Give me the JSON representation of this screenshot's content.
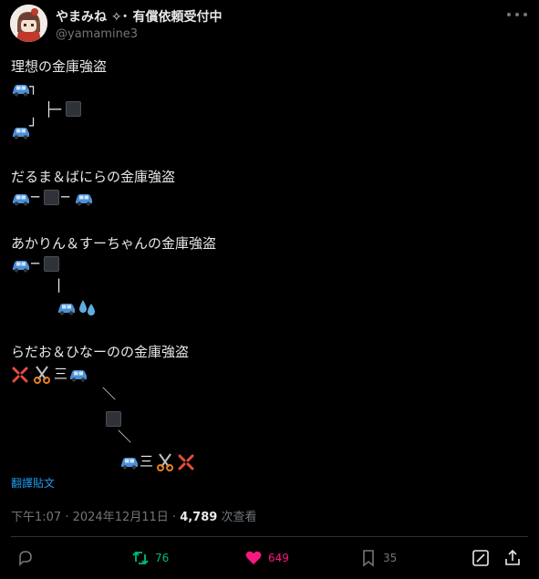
{
  "header": {
    "display_name": "やまみね ✧･ 有償依頼受付中",
    "handle": "@yamamine3"
  },
  "post": {
    "lines": [
      "理想の金庫強盗",
      "だるま＆ばにらの金庫強盗",
      "あかりん＆すーちゃんの金庫強盗",
      "らだお＆ひなーのの金庫強盗"
    ],
    "glyphs": {
      "corner_top": "┐",
      "tee": "├─",
      "corner_bottom": "┘",
      "dash": "─",
      "pipe": "|",
      "backslash": "＼",
      "speed": "三"
    }
  },
  "translate_label": "翻譯貼文",
  "meta": {
    "time": "下午1:07",
    "date": "2024年12月11日",
    "views": "4,789",
    "views_label": "次查看"
  },
  "actions": {
    "retweets": "76",
    "likes": "649",
    "bookmarks": "35"
  },
  "colors": {
    "background": "#000000",
    "text": "#e7e9ea",
    "muted": "#71767b",
    "link": "#1d9bf0",
    "retweet": "#00ba7c",
    "like": "#f91880"
  },
  "icons": [
    "car-icon",
    "vault-box-icon",
    "sweat-icon",
    "anger-icon",
    "scissors-icon",
    "reply-icon",
    "retweet-icon",
    "heart-icon",
    "bookmark-icon",
    "edit-icon",
    "share-icon"
  ]
}
